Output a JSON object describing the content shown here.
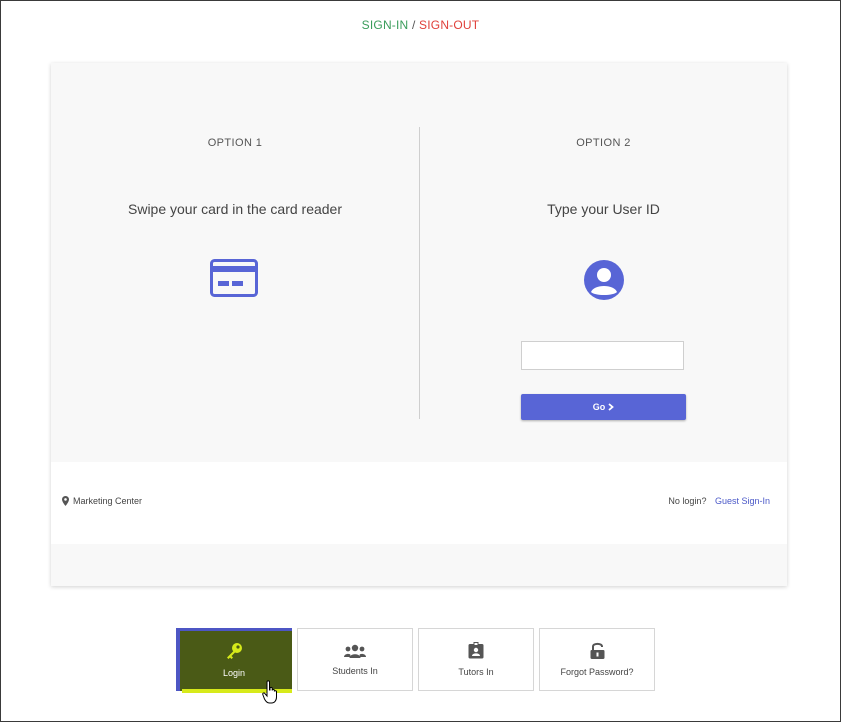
{
  "header": {
    "sign_in": "SIGN-IN",
    "separator": "/",
    "sign_out": "SIGN-OUT"
  },
  "option1": {
    "label": "OPTION 1",
    "heading": "Swipe your card in the card reader",
    "icon": "credit-card-icon"
  },
  "option2": {
    "label": "OPTION 2",
    "heading": "Type your User ID",
    "icon": "user-circle-icon",
    "input_value": "",
    "input_placeholder": "",
    "go_label": "Go"
  },
  "footer": {
    "location": "Marketing Center",
    "no_login": "No login?",
    "guest_link": "Guest Sign-In"
  },
  "tiles": [
    {
      "label": "Login",
      "icon": "key-icon",
      "active": true
    },
    {
      "label": "Students In",
      "icon": "users-icon",
      "active": false
    },
    {
      "label": "Tutors In",
      "icon": "id-badge-icon",
      "active": false
    },
    {
      "label": "Forgot Password?",
      "icon": "unlock-icon",
      "active": false
    }
  ],
  "colors": {
    "accent": "#5865d6",
    "sign_in": "#3a9d5b",
    "sign_out": "#e0403a",
    "active_tile": "#4a5a16",
    "active_highlight": "#d7ea1a"
  }
}
